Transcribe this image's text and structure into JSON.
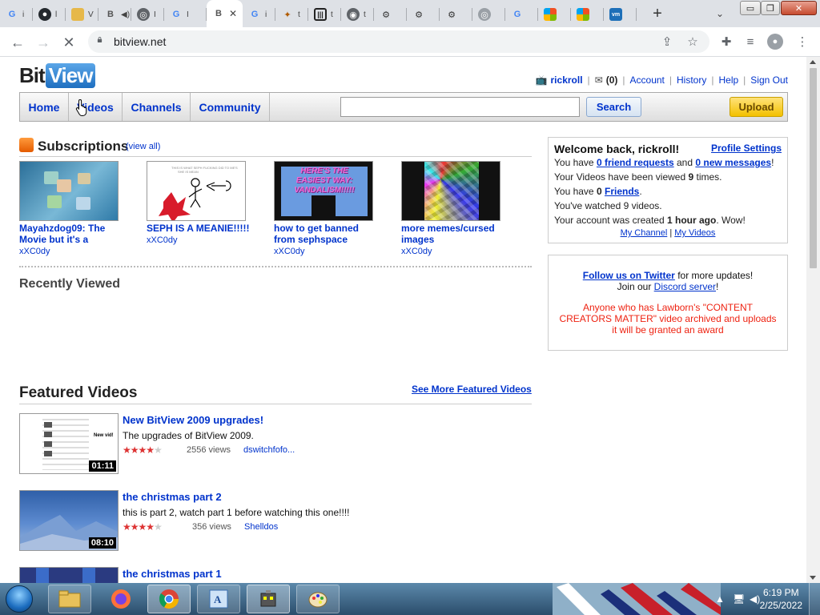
{
  "browser": {
    "tab_labels": [
      "G",
      "i",
      "",
      "l",
      "",
      "V",
      "B",
      "",
      "",
      "G",
      "i",
      "B",
      "G",
      "i",
      "t",
      "",
      "",
      "",
      "",
      "",
      "G",
      "",
      ""
    ],
    "active_tab_label": "B",
    "url": "bitview.net",
    "new_tab_symbol": "+"
  },
  "site": {
    "logo_part1": "Bit",
    "logo_part2": "View",
    "username": "rickroll",
    "inbox_count": "(0)",
    "links": [
      "Account",
      "History",
      "Help",
      "Sign Out"
    ],
    "nav": [
      "Home",
      "Videos",
      "Channels",
      "Community"
    ],
    "search_value": "",
    "search_button": "Search",
    "upload_button": "Upload"
  },
  "subscriptions": {
    "title": "Subscriptions",
    "view_all": "(view all)",
    "items": [
      {
        "title": "Mayahzdog09: The Movie but it's a",
        "user": "xXC0dy"
      },
      {
        "title": "SEPH IS A MEANIE!!!!!",
        "user": "xXC0dy"
      },
      {
        "title": "how to get banned from sephspace",
        "user": "xXC0dy"
      },
      {
        "title": "more memes/cursed images",
        "user": "xXC0dy"
      }
    ],
    "thumb3_text": "HERE'S THE EASIEST WAY: VANDALISM!!!!!"
  },
  "recently_viewed": {
    "title": "Recently Viewed"
  },
  "featured": {
    "title": "Featured Videos",
    "see_more": "See More Featured Videos",
    "videos": [
      {
        "title": "New BitView 2009 upgrades!",
        "desc": "The upgrades of BitView 2009.",
        "views": "2556 views",
        "uploader": "dswitchfofo...",
        "duration": "01:11",
        "rating": 4.5
      },
      {
        "title": "the christmas part 2",
        "desc": "this is part 2, watch part 1 before watching this one!!!!",
        "views": "356 views",
        "uploader": "Shelldos",
        "duration": "08:10",
        "rating": 4.5
      },
      {
        "title": "the christmas part 1",
        "desc": "",
        "views": "",
        "uploader": "",
        "duration": "",
        "rating": 0
      }
    ]
  },
  "welcome_box": {
    "heading": "Welcome back, rickroll!",
    "profile_settings": "Profile Settings",
    "line1_pre": "You have ",
    "friend_requests": "0 friend requests",
    "line1_mid": " and ",
    "new_messages": "0 new messages",
    "line1_post": "!",
    "line2_pre": "Your Videos have been viewed ",
    "views": "9",
    "line2_post": " times.",
    "line3_pre": "You have ",
    "friends_count": "0",
    "friends_link": "Friends",
    "line3_post": ".",
    "line4": "You've watched 9 videos.",
    "line5_pre": "Your account was created ",
    "created": "1 hour ago",
    "line5_post": ". Wow!",
    "my_channel": "My Channel",
    "link_sep": "|",
    "my_videos": "My Videos"
  },
  "follow_box": {
    "twitter_link": "Follow us on Twitter",
    "twitter_post": " for more updates!",
    "discord_pre": "Join our ",
    "discord_link": "Discord server",
    "discord_post": "!",
    "notice": "Anyone who has Lawborn's \"CONTENT CREATORS MATTER\" video archived and uploads it will be granted an award"
  },
  "taskbar": {
    "time": "6:19 PM",
    "date": "2/25/2022"
  },
  "colors": {
    "link": "#0033cc",
    "star": "#dd3333",
    "notice_red": "#ee2211",
    "upload_yellow": "#f3c100"
  }
}
